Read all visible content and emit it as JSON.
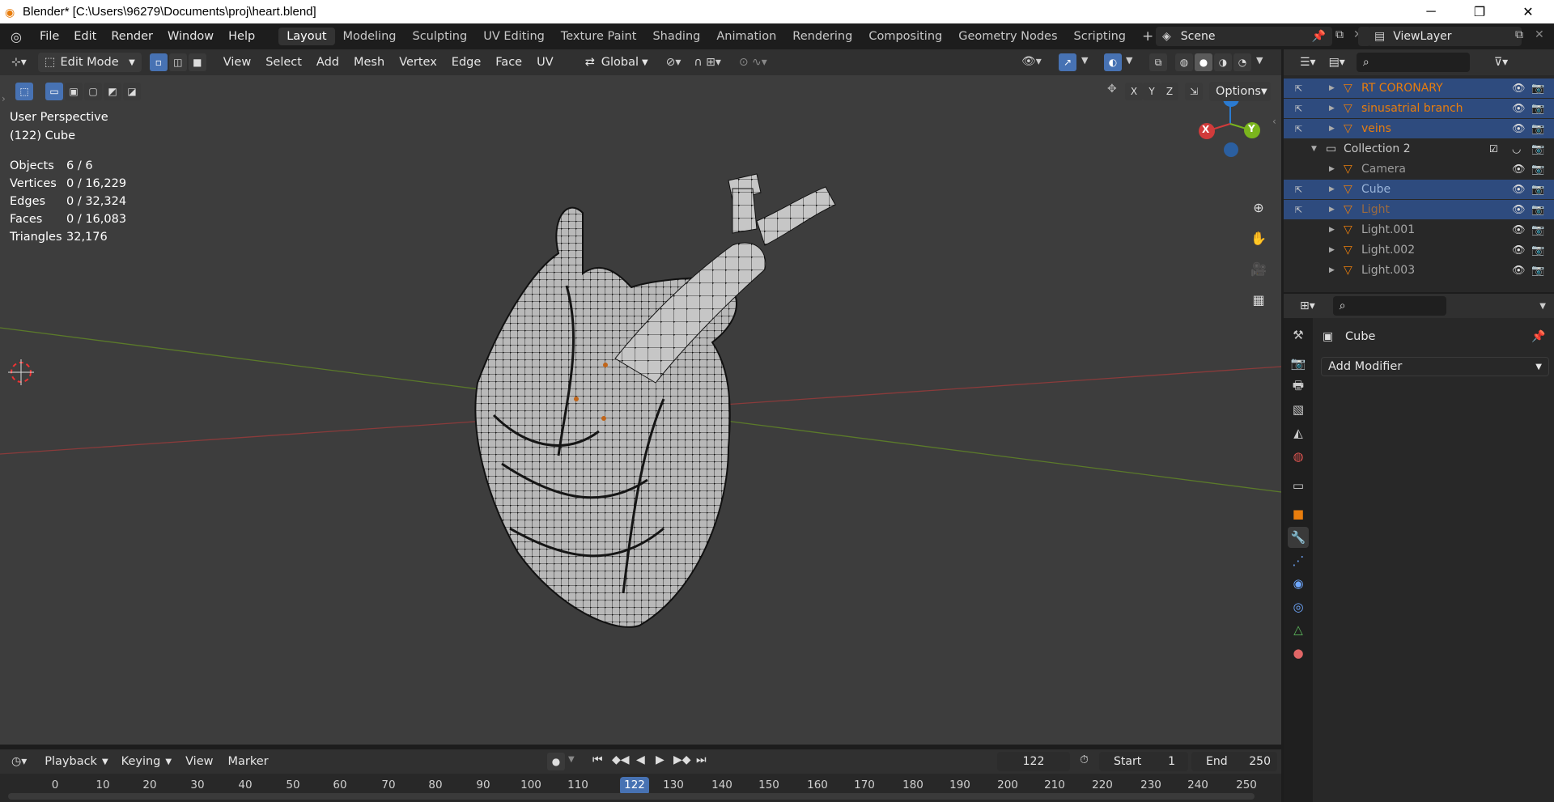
{
  "titlebar": {
    "title": "Blender* [C:\\Users\\96279\\Documents\\proj\\heart.blend]",
    "minimize": "─",
    "maximize": "❐",
    "close": "✕"
  },
  "menu": [
    "File",
    "Edit",
    "Render",
    "Window",
    "Help"
  ],
  "workspaces": [
    "Layout",
    "Modeling",
    "Sculpting",
    "UV Editing",
    "Texture Paint",
    "Shading",
    "Animation",
    "Rendering",
    "Compositing",
    "Geometry Nodes",
    "Scripting",
    "+"
  ],
  "scene": {
    "name": "Scene",
    "viewlayer": "ViewLayer"
  },
  "viewport_header": {
    "mode": "Edit Mode",
    "menus": [
      "View",
      "Select",
      "Add",
      "Mesh",
      "Vertex",
      "Edge",
      "Face",
      "UV"
    ],
    "orientation": "Global",
    "axes": [
      "X",
      "Y",
      "Z"
    ],
    "options": "Options"
  },
  "overlay": {
    "view_name": "User Perspective",
    "object_name": "(122) Cube",
    "stats": [
      {
        "label": "Objects",
        "value": "6 / 6"
      },
      {
        "label": "Vertices",
        "value": "0 / 16,229"
      },
      {
        "label": "Edges",
        "value": "0 / 32,324"
      },
      {
        "label": "Faces",
        "value": "0 / 16,083"
      },
      {
        "label": "Triangles",
        "value": "32,176"
      }
    ]
  },
  "gizmo": {
    "x": "X",
    "y": "Y",
    "z": "Z"
  },
  "outliner": {
    "rows": [
      {
        "name": "RT CORONARY",
        "color": "#e87d0d",
        "selected": true
      },
      {
        "name": "sinusatrial  branch",
        "color": "#e87d0d",
        "selected": true
      },
      {
        "name": "veins",
        "color": "#e87d0d",
        "selected": true
      },
      {
        "name": "Collection 2",
        "color": "#c8c8c8",
        "selected": false
      },
      {
        "name": "Camera",
        "color": "#9a9a9a",
        "selected": false
      },
      {
        "name": "Cube",
        "color": "#9ab4d9",
        "selected": true
      },
      {
        "name": "Light",
        "color": "#9a6a40",
        "selected": true
      },
      {
        "name": "Light.001",
        "color": "#a8a8a8",
        "selected": false
      },
      {
        "name": "Light.002",
        "color": "#a8a8a8",
        "selected": false
      },
      {
        "name": "Light.003",
        "color": "#a8a8a8",
        "selected": false
      }
    ]
  },
  "properties": {
    "object": "Cube",
    "add_modifier": "Add Modifier"
  },
  "timeline": {
    "menus": [
      "Playback",
      "Keying",
      "View",
      "Marker"
    ],
    "current_frame": "122",
    "start_label": "Start",
    "start": "1",
    "end_label": "End",
    "end": "250",
    "ticks": [
      "0",
      "10",
      "20",
      "30",
      "40",
      "50",
      "60",
      "70",
      "80",
      "90",
      "100",
      "110",
      "122",
      "130",
      "140",
      "150",
      "160",
      "170",
      "180",
      "190",
      "200",
      "210",
      "220",
      "230",
      "240",
      "250"
    ]
  }
}
